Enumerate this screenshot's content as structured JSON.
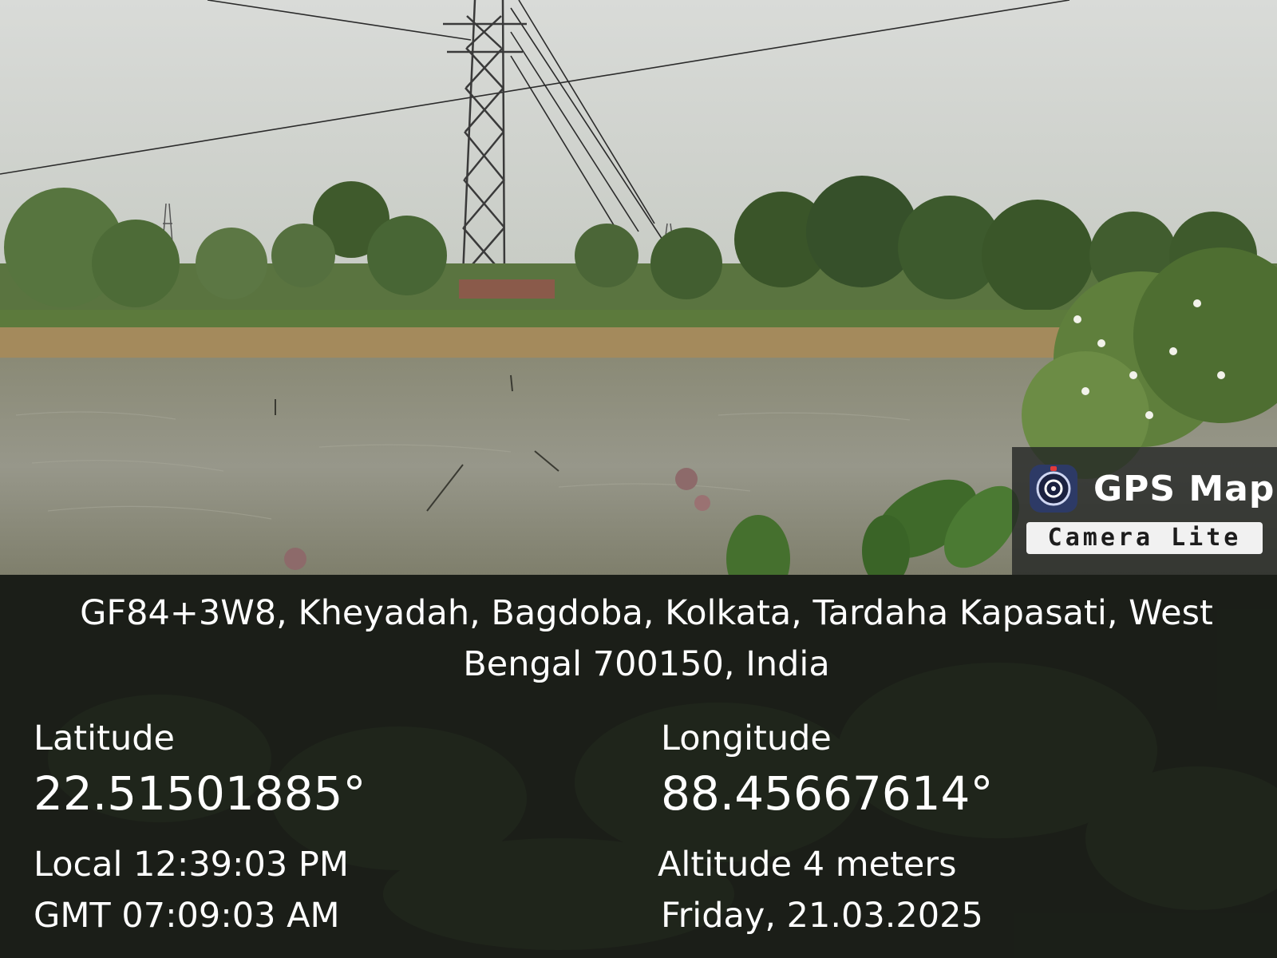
{
  "watermark": {
    "title": "GPS Map",
    "subtitle": "Camera Lite",
    "icon": "camera-lens-icon"
  },
  "location": {
    "address": "GF84+3W8, Kheyadah, Bagdoba, Kolkata, Tardaha Kapasati, West Bengal 700150, India",
    "latitude_label": "Latitude",
    "latitude_value": "22.51501885°",
    "longitude_label": "Longitude",
    "longitude_value": "88.45667614°",
    "local_time": "Local 12:39:03 PM",
    "gmt_time": "GMT 07:09:03 AM",
    "altitude": "Altitude 4 meters",
    "date": "Friday, 21.03.2025"
  },
  "colors": {
    "sky": "#d6d8d4",
    "water": "#8c8d78",
    "foliage": "#3f5a2c",
    "panel": "#121312"
  }
}
